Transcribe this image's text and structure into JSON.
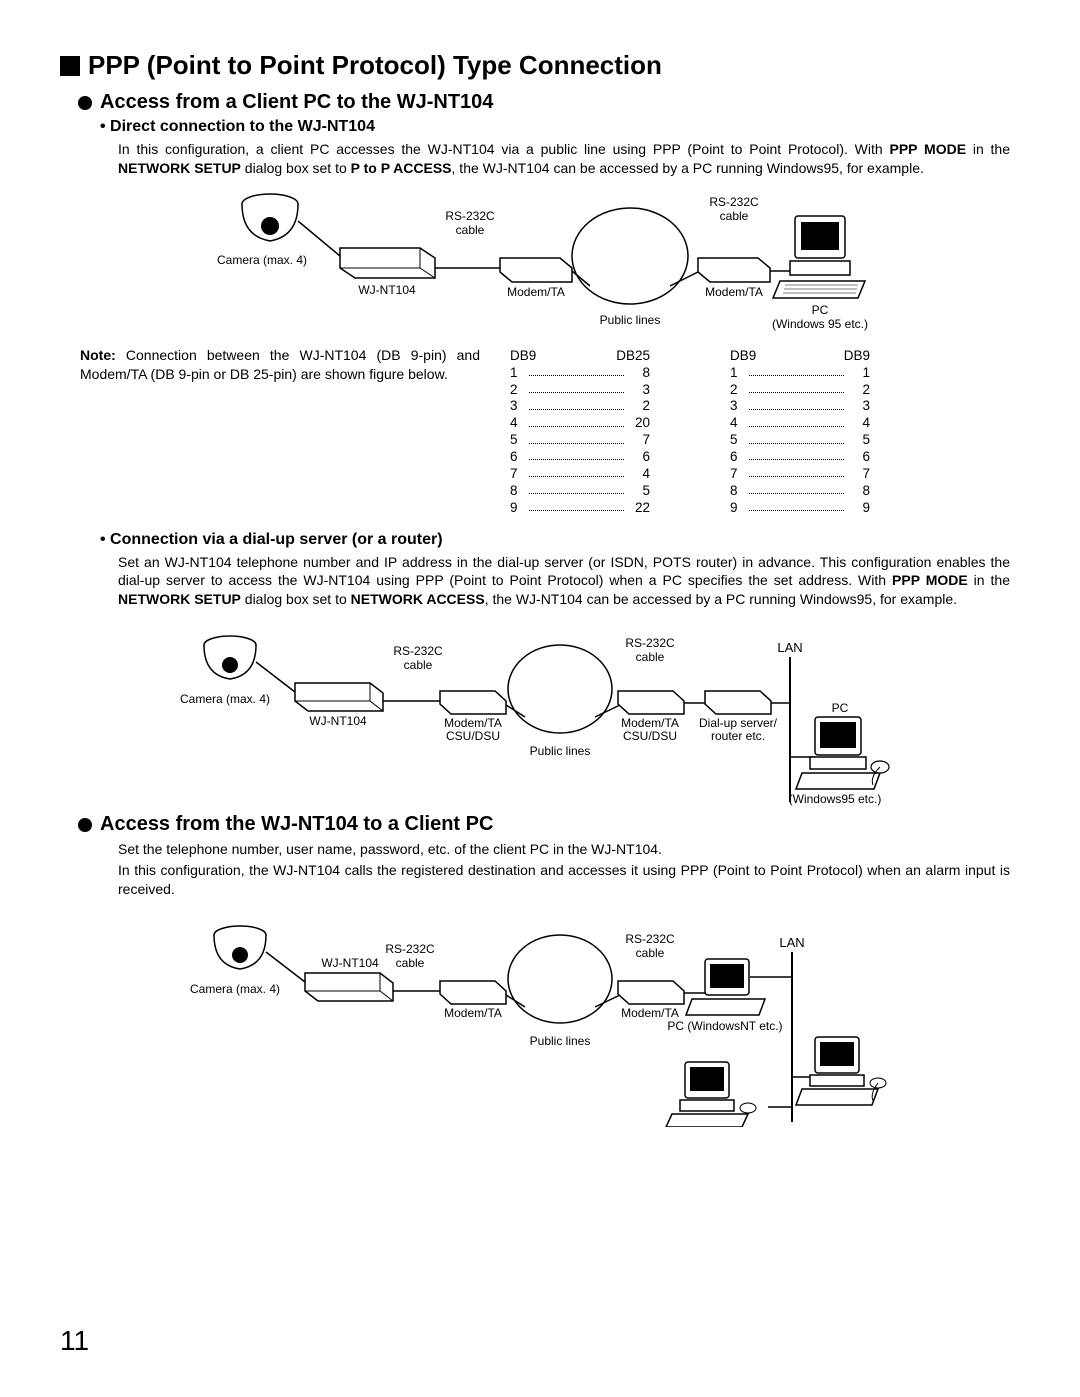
{
  "h1": "PPP (Point to Point Protocol) Type Connection",
  "sectionA": {
    "title": "Access from a Client PC to the WJ-NT104",
    "sub1": {
      "title": "• Direct connection to the WJ-NT104",
      "para_pre": "In this configuration, a client PC accesses the WJ-NT104 via a public line using PPP (Point to Point Protocol). With ",
      "b1": "PPP MODE",
      "mid1": " in the ",
      "b2": "NETWORK SETUP",
      "mid2": " dialog box set to ",
      "b3": "P to P ACCESS",
      "post": ", the WJ-NT104 can be accessed by a PC running Windows95, for example."
    },
    "note": {
      "label": "Note:",
      "text": " Connection between the WJ-NT104 (DB 9-pin) and Modem/TA (DB 9-pin or DB 25-pin) are shown figure below."
    },
    "pins1": {
      "h_l": "DB9",
      "h_r": "DB25",
      "rows": [
        {
          "l": "1",
          "r": "8"
        },
        {
          "l": "2",
          "r": "3"
        },
        {
          "l": "3",
          "r": "2"
        },
        {
          "l": "4",
          "r": "20"
        },
        {
          "l": "5",
          "r": "7"
        },
        {
          "l": "6",
          "r": "6"
        },
        {
          "l": "7",
          "r": "4"
        },
        {
          "l": "8",
          "r": "5"
        },
        {
          "l": "9",
          "r": "22"
        }
      ]
    },
    "pins2": {
      "h_l": "DB9",
      "h_r": "DB9",
      "rows": [
        {
          "l": "1",
          "r": "1"
        },
        {
          "l": "2",
          "r": "2"
        },
        {
          "l": "3",
          "r": "3"
        },
        {
          "l": "4",
          "r": "4"
        },
        {
          "l": "5",
          "r": "5"
        },
        {
          "l": "6",
          "r": "6"
        },
        {
          "l": "7",
          "r": "7"
        },
        {
          "l": "8",
          "r": "8"
        },
        {
          "l": "9",
          "r": "9"
        }
      ]
    },
    "sub2": {
      "title": "• Connection via a dial-up server (or a router)",
      "para_pre": "Set an WJ-NT104 telephone number and IP address in the dial-up server (or ISDN, POTS router) in advance. This configuration enables the dial-up server to access the WJ-NT104 using PPP (Point to Point Protocol) when a PC specifies the set address. With ",
      "b1": "PPP MODE",
      "mid1": " in the ",
      "b2": "NETWORK SETUP",
      "mid2": " dialog box set to ",
      "b3": "NETWORK ACCESS",
      "post": ", the WJ-NT104 can be accessed by a PC running Windows95, for example."
    }
  },
  "sectionB": {
    "title": "Access from the WJ-NT104 to a Client PC",
    "para1": "Set the telephone number, user name, password, etc. of the client PC in the WJ-NT104.",
    "para2": "In this configuration, the WJ-NT104 calls the registered destination and accesses it using PPP (Point to Point Protocol) when an alarm input is received."
  },
  "diag1": {
    "camera": "Camera (max. 4)",
    "wj": "WJ-NT104",
    "rs": "RS-232C",
    "cable": "cable",
    "modem": "Modem/TA",
    "public": "Public lines",
    "pc": "PC",
    "pcsub": "(Windows 95 etc.)"
  },
  "diag2": {
    "camera": "Camera (max. 4)",
    "wj": "WJ-NT104",
    "rs": "RS-232C",
    "cable": "cable",
    "csu": "CSU/DSU",
    "modem": "Modem/TA",
    "public": "Public lines",
    "dial": "Dial-up server/",
    "router": "router etc.",
    "lan": "LAN",
    "pc": "PC",
    "pcsub": "(Windows95 etc.)"
  },
  "diag3": {
    "camera": "Camera (max. 4)",
    "wj": "WJ-NT104",
    "rs": "RS-232C",
    "cable": "cable",
    "modem": "Modem/TA",
    "public": "Public lines",
    "lan": "LAN",
    "pc_nt": "PC (WindowsNT etc.)"
  },
  "page_number": "11"
}
